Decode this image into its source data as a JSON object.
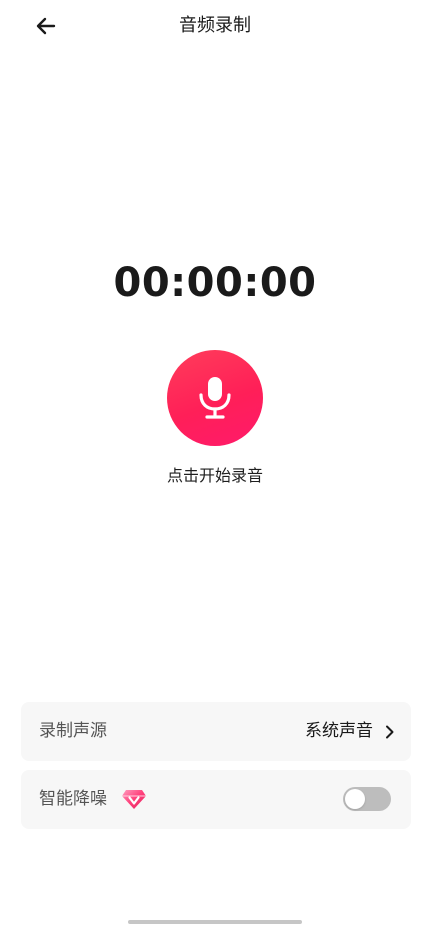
{
  "header": {
    "title": "音频录制",
    "back_icon": "arrow-left-icon"
  },
  "recorder": {
    "timer": "00:00:00",
    "hint": "点击开始录音",
    "button_icon": "microphone-icon",
    "accent_color": "#ff2a5c",
    "state": "idle"
  },
  "settings": {
    "source": {
      "label": "录制声源",
      "value": "系统声音",
      "icon": "chevron-right-icon"
    },
    "noise_reduction": {
      "label": "智能降噪",
      "badge_icon": "vip-diamond-icon",
      "enabled": false
    }
  }
}
